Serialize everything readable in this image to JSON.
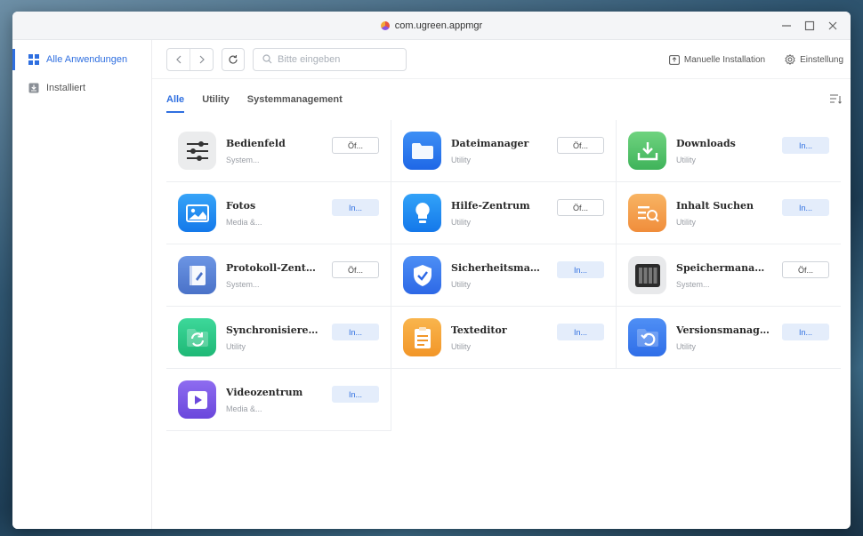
{
  "window": {
    "title": "com.ugreen.appmgr"
  },
  "sidebar": {
    "items": [
      {
        "label": "Alle Anwendungen",
        "icon": "grid-icon",
        "active": true
      },
      {
        "label": "Installiert",
        "icon": "download-box-icon",
        "active": false
      }
    ]
  },
  "toolbar": {
    "search_placeholder": "Bitte eingeben",
    "manual_install_label": "Manuelle Installation",
    "settings_label": "Einstellung"
  },
  "tabs": [
    {
      "label": "Alle",
      "active": true
    },
    {
      "label": "Utility",
      "active": false
    },
    {
      "label": "Systemmanagement",
      "active": false
    }
  ],
  "apps": [
    {
      "name": "Bedienfeld",
      "category": "System...",
      "action": "Öf...",
      "state": "open",
      "icon": "sliders-icon",
      "color": "#ebeced"
    },
    {
      "name": "Dateimanager",
      "category": "Utility",
      "action": "Öf...",
      "state": "open",
      "icon": "folder-icon",
      "color": "#2f7ff0"
    },
    {
      "name": "Downloads",
      "category": "Utility",
      "action": "In...",
      "state": "install",
      "icon": "download-tray-icon",
      "color": "#5cc56f"
    },
    {
      "name": "Fotos",
      "category": "Media &...",
      "action": "In...",
      "state": "install",
      "icon": "photo-icon",
      "color": "#1f8ff5"
    },
    {
      "name": "Hilfe-Zentrum",
      "category": "Utility",
      "action": "Öf...",
      "state": "open",
      "icon": "lightbulb-icon",
      "color": "#1e90f5"
    },
    {
      "name": "Inhalt Suchen",
      "category": "Utility",
      "action": "In...",
      "state": "install",
      "icon": "content-search-icon",
      "color": "#f4a54e"
    },
    {
      "name": "Protokoll-Zentrum",
      "category": "System...",
      "action": "Öf...",
      "state": "open",
      "icon": "log-book-icon",
      "color": "#5a84d8"
    },
    {
      "name": "Sicherheitsmanager",
      "category": "Utility",
      "action": "In...",
      "state": "install",
      "icon": "shield-check-icon",
      "color": "#3e7fef"
    },
    {
      "name": "Speichermanager",
      "category": "System...",
      "action": "Öf...",
      "state": "open",
      "icon": "storage-drives-icon",
      "color": "#e8e9eb"
    },
    {
      "name": "Synchronisieren & ...",
      "category": "Utility",
      "action": "In...",
      "state": "install",
      "icon": "sync-folder-icon",
      "color": "#2fc98a"
    },
    {
      "name": "Texteditor",
      "category": "Utility",
      "action": "In...",
      "state": "install",
      "icon": "notepad-icon",
      "color": "#f7a53a"
    },
    {
      "name": "Versionsmanager",
      "category": "Utility",
      "action": "In...",
      "state": "install",
      "icon": "version-restore-icon",
      "color": "#3b7ff2"
    },
    {
      "name": "Videozentrum",
      "category": "Media &...",
      "action": "In...",
      "state": "install",
      "icon": "video-play-icon",
      "color": "#7c5be8"
    }
  ]
}
